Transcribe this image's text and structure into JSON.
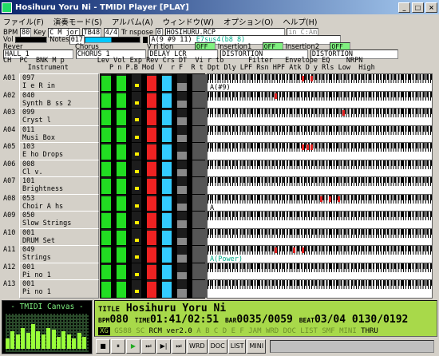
{
  "window": {
    "title": "Hosihuru Yoru  Ni - TMIDI Player [PLAY]",
    "minimize": "_",
    "maximize": "□",
    "close": "×"
  },
  "menu": [
    "ファイル(F)",
    "演奏モード(S)",
    "アルバム(A)",
    "ウィンドウ(W)",
    "オプション(O)",
    "ヘルプ(H)"
  ],
  "status": {
    "bpm_label": "BPM",
    "bpm": "80",
    "key_label": "Key",
    "key": "C M jor",
    "tb": "TB48",
    "timesig": "4/4",
    "transpose_label": "Tr nspose",
    "transpose": "0",
    "file": "HOSIHURU.RCP",
    "key_right": "in C:Am",
    "vol_label": "Vol",
    "notes_label": "Notes",
    "notes": "017",
    "chord": "A(9 #9 11)",
    "chord2": "E7sus4(b8 8)",
    "reverb_label": "Rever",
    "reverb": "HALL 1",
    "chorus_label": "Chorus",
    "chorus": "CHORUS 1",
    "variation_label": "V ri tion",
    "variation": "DELAY LCR",
    "variation_state": "OFF",
    "ins1_label": "Insertion1",
    "ins1": "DISTORTION",
    "ins1_state": "OFF",
    "ins2_label": "Insertion2",
    "ins2": "DISTORTION",
    "ins2_state": "OFF"
  },
  "header": {
    "line1": "CH  PC  BNK M p        Lev Vol Exp Rev Crs DT  Vi r to      Filter   Envelope EQ    NRPN",
    "line2": "      Instrument          P n P.B Mod V  r F  R t Dpt Dly LPF Rsn HPF Atk D y Rls Low  High"
  },
  "channels": [
    {
      "ch": "A01",
      "pc": "097",
      "name": "I e R in",
      "chord": "A(#9)",
      "meters": [
        0.9,
        0.9,
        0.9,
        0.9,
        0.9,
        0.5
      ],
      "hits": [
        0.42,
        0.46
      ]
    },
    {
      "ch": "A02",
      "pc": "040",
      "name": "Synth B ss 2",
      "chord": "",
      "meters": [
        0.9,
        0.9,
        0.3,
        0.9,
        0.9,
        0.5
      ],
      "hits": [
        0.3
      ]
    },
    {
      "ch": "A03",
      "pc": "099",
      "name": "Cryst l",
      "chord": "",
      "meters": [
        0.9,
        0.9,
        0.3,
        0.9,
        0.9,
        0.5
      ],
      "hits": [
        0.6
      ]
    },
    {
      "ch": "A04",
      "pc": "011",
      "name": "Musi  Box",
      "chord": "",
      "meters": [
        0.9,
        0.9,
        0.3,
        0.9,
        0.9,
        0.5
      ],
      "hits": []
    },
    {
      "ch": "A05",
      "pc": "103",
      "name": "E ho Drops",
      "chord": "",
      "meters": [
        0.9,
        0.9,
        0.3,
        0.9,
        0.9,
        0.5
      ],
      "hits": [
        0.42,
        0.44,
        0.46
      ]
    },
    {
      "ch": "A06",
      "pc": "008",
      "name": "Cl v.",
      "chord": "",
      "meters": [
        0.9,
        0.9,
        0.3,
        0.9,
        0.9,
        0.5
      ],
      "hits": []
    },
    {
      "ch": "A07",
      "pc": "101",
      "name": "Brightness",
      "chord": "",
      "meters": [
        0.9,
        0.9,
        0.3,
        0.9,
        0.9,
        0.5
      ],
      "hits": []
    },
    {
      "ch": "A08",
      "pc": "053",
      "name": "Choir A hs",
      "chord": "A",
      "meters": [
        0.9,
        0.9,
        0.3,
        0.9,
        0.9,
        0.5
      ],
      "hits": [
        0.5,
        0.54,
        0.58
      ]
    },
    {
      "ch": "A09",
      "pc": "050",
      "name": "Slow Strings",
      "chord": "",
      "meters": [
        0.9,
        0.9,
        0.3,
        0.9,
        0.9,
        0.5
      ],
      "hits": []
    },
    {
      "ch": "A10",
      "pc": "001",
      "name": "DRUM Set",
      "chord": "",
      "meters": [
        0.9,
        0.9,
        0.3,
        0.9,
        0.9,
        0.5
      ],
      "hits": []
    },
    {
      "ch": "A11",
      "pc": "049",
      "name": "Strings",
      "chord": "A(Power)",
      "meters": [
        0.9,
        0.9,
        0.3,
        0.9,
        0.9,
        0.5
      ],
      "hits": [
        0.3,
        0.38,
        0.42
      ]
    },
    {
      "ch": "A12",
      "pc": "001",
      "name": "Pi no 1",
      "chord": "",
      "meters": [
        0.9,
        0.9,
        0.3,
        0.9,
        0.9,
        0.5
      ],
      "hits": []
    },
    {
      "ch": "A13",
      "pc": "001",
      "name": "Pi no 1",
      "chord": "",
      "meters": [
        0.9,
        0.9,
        0.3,
        0.9,
        0.9,
        0.5
      ],
      "hits": []
    }
  ],
  "canvas": {
    "label": "- TMIDI Canvas -",
    "levels": [
      0.3,
      0.5,
      0.4,
      0.6,
      0.45,
      0.7,
      0.5,
      0.4,
      0.6,
      0.55,
      0.35,
      0.5,
      0.4,
      0.3,
      0.45,
      0.35
    ]
  },
  "info": {
    "title_label": "TITLE",
    "title": "Hosihuru Yoru  Ni",
    "bpm_label": "BPM",
    "bpm": "080",
    "time_label": "TIME",
    "time": "01:41/02:51",
    "bar_label": "BAR",
    "bar": "0035/0059",
    "beat_label": "BEAT",
    "beat": "03/04",
    "tick": "0130/0192",
    "xg": "XG",
    "gs_label": "GS88 SC",
    "rcm": "RCM ver2.0",
    "ab": "A B C D E F",
    "jam": "JAM",
    "wrd": "WRD DOC LIST SMF MINI",
    "thru": "THRU"
  },
  "controls": [
    "■",
    "⏸",
    "▶",
    "⏭",
    "▶|",
    "⏭",
    "WRD",
    "DOC",
    "LIST",
    "MINI"
  ]
}
